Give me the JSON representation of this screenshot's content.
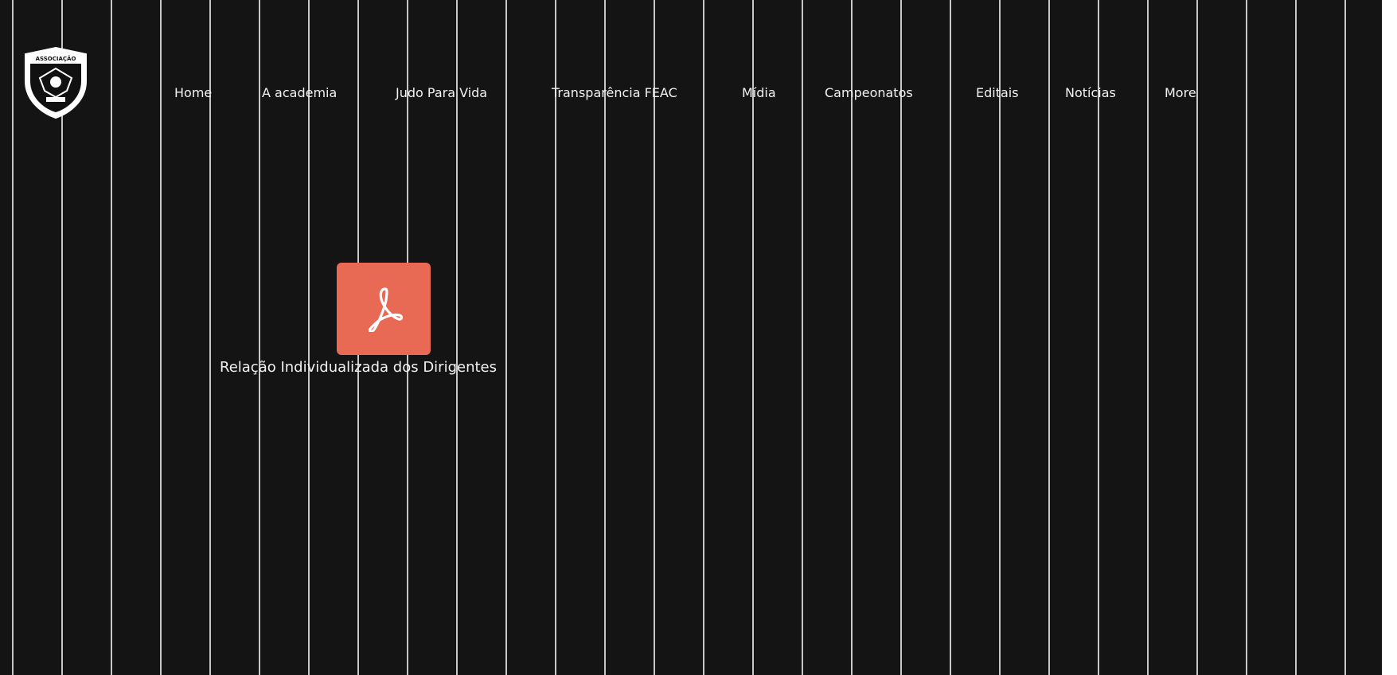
{
  "header": {
    "logo": {
      "name": "association-shield-logo",
      "text": "ASSOCIAÇÃO"
    },
    "nav": [
      {
        "label": "Home"
      },
      {
        "label": "A academia"
      },
      {
        "label": "Judo Para Vida"
      },
      {
        "label": "Transparência FEAC"
      },
      {
        "label": "Mídia"
      },
      {
        "label": "Campeonatos"
      },
      {
        "label": "Editais"
      },
      {
        "label": "Notícias"
      },
      {
        "label": "More"
      }
    ]
  },
  "main": {
    "document": {
      "icon": "pdf-icon",
      "label": "Relação Individualizada dos Dirigentes"
    }
  },
  "colors": {
    "background": "#141414",
    "stripe": "#e6e6e6",
    "pdf_card": "#e86a55",
    "text": "#f2f2f2"
  }
}
